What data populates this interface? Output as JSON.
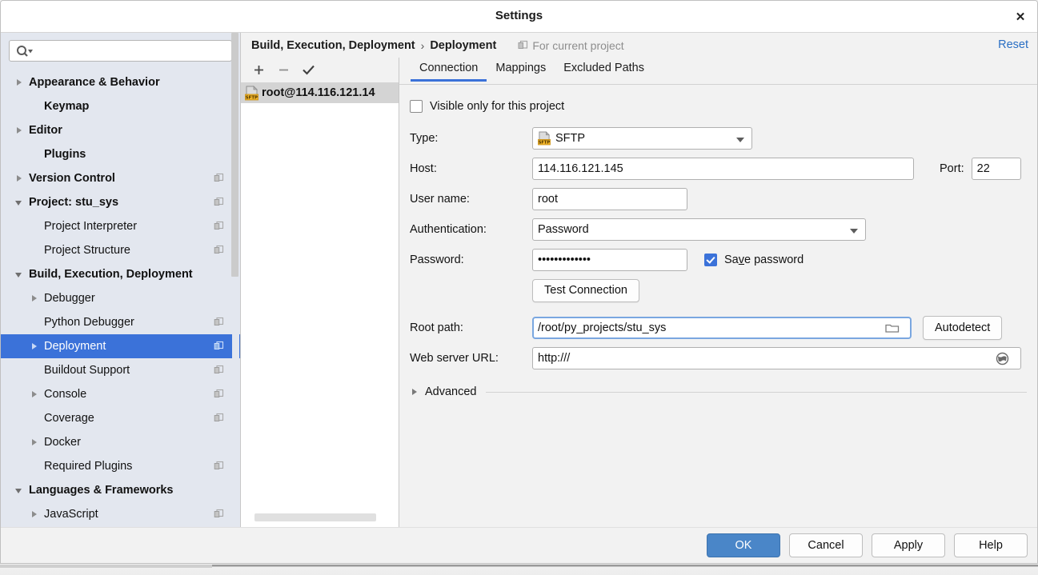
{
  "window": {
    "title": "Settings",
    "close_icon": "close-icon"
  },
  "sidebar": {
    "search": {
      "placeholder": "",
      "value": "",
      "icon": "search-icon"
    },
    "items": [
      {
        "label": "Appearance & Behavior",
        "indent": 0,
        "twisty": "right",
        "bold": true,
        "badge": false,
        "selected": false
      },
      {
        "label": "Keymap",
        "indent": 1,
        "twisty": "none",
        "bold": true,
        "badge": false,
        "selected": false
      },
      {
        "label": "Editor",
        "indent": 0,
        "twisty": "right",
        "bold": true,
        "badge": false,
        "selected": false
      },
      {
        "label": "Plugins",
        "indent": 1,
        "twisty": "none",
        "bold": true,
        "badge": false,
        "selected": false
      },
      {
        "label": "Version Control",
        "indent": 0,
        "twisty": "right",
        "bold": true,
        "badge": true,
        "selected": false
      },
      {
        "label": "Project: stu_sys",
        "indent": 0,
        "twisty": "down",
        "bold": true,
        "badge": true,
        "selected": false
      },
      {
        "label": "Project Interpreter",
        "indent": 1,
        "twisty": "none",
        "bold": false,
        "badge": true,
        "selected": false
      },
      {
        "label": "Project Structure",
        "indent": 1,
        "twisty": "none",
        "bold": false,
        "badge": true,
        "selected": false
      },
      {
        "label": "Build, Execution, Deployment",
        "indent": 0,
        "twisty": "down",
        "bold": true,
        "badge": false,
        "selected": false
      },
      {
        "label": "Debugger",
        "indent": 1,
        "twisty": "right",
        "bold": false,
        "badge": false,
        "selected": false
      },
      {
        "label": "Python Debugger",
        "indent": 2,
        "twisty": "none",
        "bold": false,
        "badge": true,
        "selected": false
      },
      {
        "label": "Deployment",
        "indent": 1,
        "twisty": "right",
        "bold": false,
        "badge": true,
        "selected": true
      },
      {
        "label": "Buildout Support",
        "indent": 2,
        "twisty": "none",
        "bold": false,
        "badge": true,
        "selected": false
      },
      {
        "label": "Console",
        "indent": 1,
        "twisty": "right",
        "bold": false,
        "badge": true,
        "selected": false
      },
      {
        "label": "Coverage",
        "indent": 2,
        "twisty": "none",
        "bold": false,
        "badge": true,
        "selected": false
      },
      {
        "label": "Docker",
        "indent": 1,
        "twisty": "right",
        "bold": false,
        "badge": false,
        "selected": false
      },
      {
        "label": "Required Plugins",
        "indent": 2,
        "twisty": "none",
        "bold": false,
        "badge": true,
        "selected": false
      },
      {
        "label": "Languages & Frameworks",
        "indent": 0,
        "twisty": "down",
        "bold": true,
        "badge": false,
        "selected": false
      },
      {
        "label": "JavaScript",
        "indent": 1,
        "twisty": "right",
        "bold": false,
        "badge": true,
        "selected": false
      }
    ]
  },
  "header": {
    "breadcrumb_1": "Build, Execution, Deployment",
    "breadcrumb_sep": "›",
    "breadcrumb_2": "Deployment",
    "for_current_project": "For current project",
    "reset_label": "Reset"
  },
  "server_list": {
    "toolbar": {
      "add_label": "+",
      "remove_label": "−",
      "default_label": "✓"
    },
    "items": [
      {
        "label": "root@114.116.121.14",
        "icon": "sftp-icon",
        "selected": true
      }
    ]
  },
  "tabs": [
    {
      "label": "Connection",
      "active": true
    },
    {
      "label": "Mappings",
      "active": false
    },
    {
      "label": "Excluded Paths",
      "active": false
    }
  ],
  "form": {
    "visible_only_label": "Visible only for this project",
    "visible_only_checked": false,
    "type_label": "Type:",
    "type_value": "SFTP",
    "host_label": "Host:",
    "host_value": "114.116.121.145",
    "port_label": "Port:",
    "port_value": "22",
    "username_label": "User name:",
    "username_value": "root",
    "auth_label": "Authentication:",
    "auth_value": "Password",
    "password_label": "Password:",
    "password_value": "•••••••••••••",
    "save_password_label_pre": "Sa",
    "save_password_label_mnemonic": "v",
    "save_password_label_post": "e password",
    "save_password_checked": true,
    "test_connection_label": "Test Connection",
    "root_path_label": "Root path:",
    "root_path_value": "/root/py_projects/stu_sys",
    "autodetect_label": "Autodetect",
    "web_server_url_label": "Web server URL:",
    "web_server_url_value": "http:///",
    "advanced_label": "Advanced",
    "advanced_expanded": false
  },
  "footer": {
    "ok_label": "OK",
    "cancel_label": "Cancel",
    "apply_label": "Apply",
    "help_label": "Help"
  },
  "colors": {
    "accent": "#3b72d9",
    "primary_button": "#4a86c8",
    "link": "#2a6fc4",
    "sidebar_bg": "#e3e7ef",
    "panel_bg": "#f2f2f2"
  }
}
